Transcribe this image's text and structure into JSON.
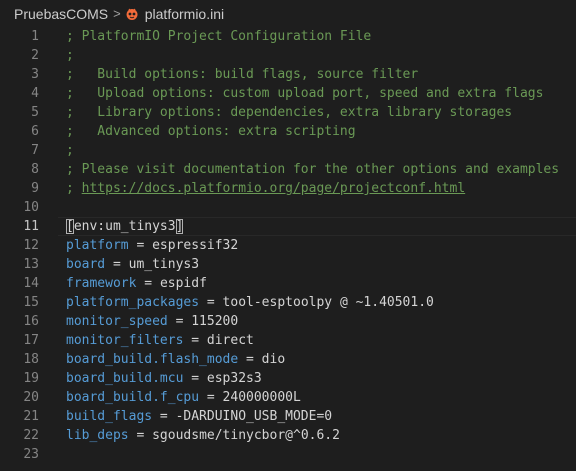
{
  "breadcrumb": {
    "folder": "PruebasCOMS",
    "separator": ">",
    "file": "platformio.ini"
  },
  "editor": {
    "active_line": 11,
    "lines": [
      {
        "n": "1",
        "type": "comment",
        "text": "; PlatformIO Project Configuration File"
      },
      {
        "n": "2",
        "type": "comment",
        "text": ";"
      },
      {
        "n": "3",
        "type": "comment",
        "text": ";   Build options: build flags, source filter"
      },
      {
        "n": "4",
        "type": "comment",
        "text": ";   Upload options: custom upload port, speed and extra flags"
      },
      {
        "n": "5",
        "type": "comment",
        "text": ";   Library options: dependencies, extra library storages"
      },
      {
        "n": "6",
        "type": "comment",
        "text": ";   Advanced options: extra scripting"
      },
      {
        "n": "7",
        "type": "comment",
        "text": ";"
      },
      {
        "n": "8",
        "type": "comment",
        "text": "; Please visit documentation for the other options and examples"
      },
      {
        "n": "9",
        "type": "link",
        "prefix": "; ",
        "text": "https://docs.platformio.org/page/projectconf.html"
      },
      {
        "n": "10",
        "type": "blank",
        "text": ""
      },
      {
        "n": "11",
        "type": "section",
        "open": "[",
        "text": "env:um_tinys3",
        "close": "]"
      },
      {
        "n": "12",
        "type": "kv",
        "key": "platform",
        "value": "espressif32"
      },
      {
        "n": "13",
        "type": "kv",
        "key": "board",
        "value": "um_tinys3"
      },
      {
        "n": "14",
        "type": "kv",
        "key": "framework",
        "value": "espidf"
      },
      {
        "n": "15",
        "type": "kv",
        "key": "platform_packages",
        "value": "tool-esptoolpy @ ~1.40501.0"
      },
      {
        "n": "16",
        "type": "kv",
        "key": "monitor_speed",
        "value": "115200"
      },
      {
        "n": "17",
        "type": "kv",
        "key": "monitor_filters",
        "value": "direct"
      },
      {
        "n": "18",
        "type": "kv",
        "key": "board_build.flash_mode",
        "value": "dio"
      },
      {
        "n": "19",
        "type": "kv",
        "key": "board_build.mcu",
        "value": "esp32s3"
      },
      {
        "n": "20",
        "type": "kv",
        "key": "board_build.f_cpu",
        "value": "240000000L"
      },
      {
        "n": "21",
        "type": "kv",
        "key": "build_flags",
        "value": "-DARDUINO_USB_MODE=0"
      },
      {
        "n": "22",
        "type": "kv",
        "key": "lib_deps",
        "value": "sgoudsme/tinycbor@^0.6.2"
      },
      {
        "n": "23",
        "type": "blank",
        "text": ""
      }
    ]
  },
  "colors": {
    "background": "#1e1e1e",
    "comment": "#6a9955",
    "key": "#569cd6",
    "text": "#d4d4d4",
    "icon": "#f26b3a"
  },
  "icons": {
    "file_icon": "platformio-alien-icon"
  }
}
